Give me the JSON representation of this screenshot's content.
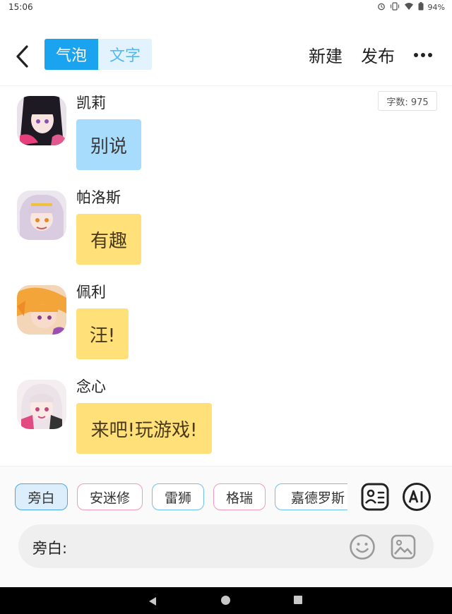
{
  "status_bar": {
    "time": "15:06",
    "battery": "94%",
    "icons": [
      "alarm-icon",
      "vibrate-icon",
      "wifi-icon",
      "battery-icon"
    ]
  },
  "header": {
    "tab_bubble": "气泡",
    "tab_text": "文字",
    "new_label": "新建",
    "publish_label": "发布"
  },
  "word_count": "字数: 975",
  "messages": [
    {
      "name": "凯莉",
      "text": "别说",
      "bubble_color": "#a8dcfc"
    },
    {
      "name": "帕洛斯",
      "text": "有趣",
      "bubble_color": "#ffe079"
    },
    {
      "name": "佩利",
      "text": "汪!",
      "bubble_color": "#ffe079"
    },
    {
      "name": "念心",
      "text": "来吧!玩游戏!",
      "bubble_color": "#ffe079"
    }
  ],
  "characters": [
    "旁白",
    "安迷修",
    "雷狮",
    "格瑞",
    "嘉德罗斯"
  ],
  "input": {
    "prefix": "旁白:",
    "value": "",
    "placeholder": ""
  },
  "colors": {
    "accent": "#1aa4f0",
    "bubble_blue": "#a8dcfc",
    "bubble_yellow": "#ffe079"
  }
}
